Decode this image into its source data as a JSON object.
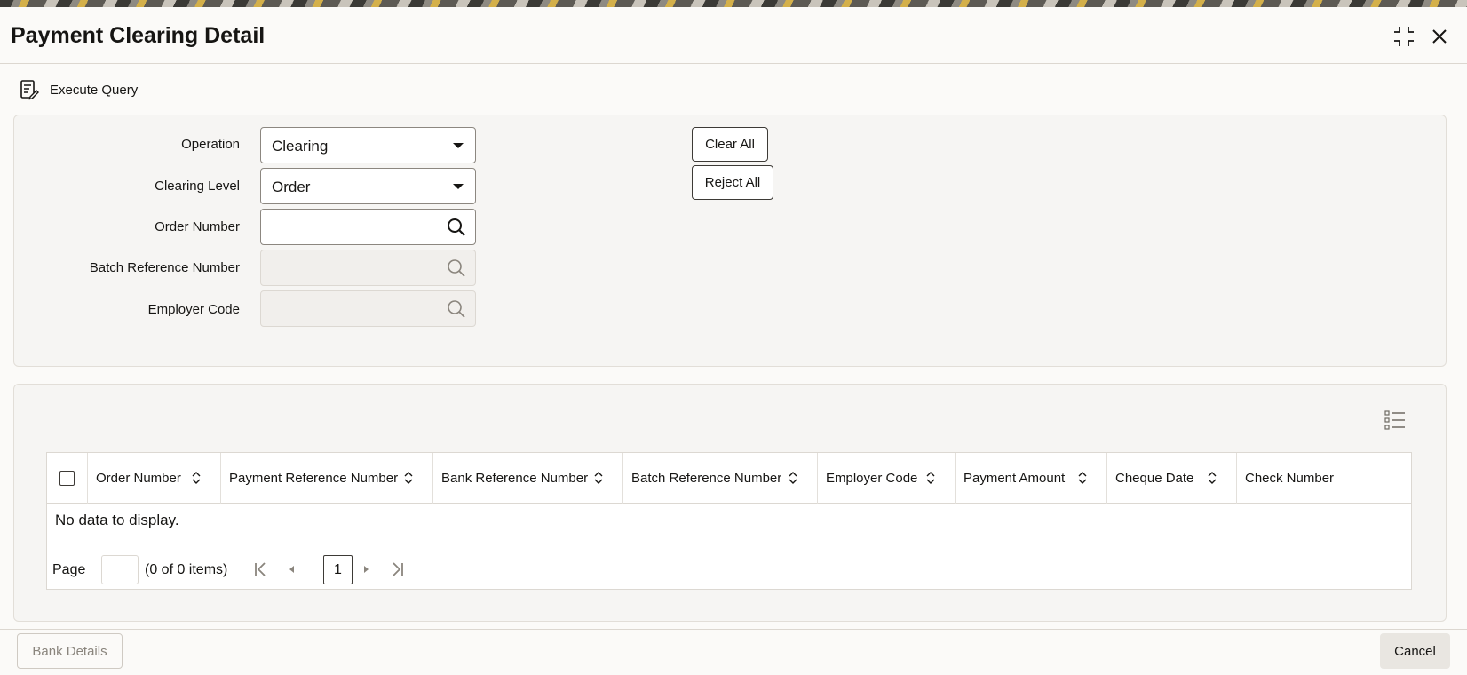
{
  "window": {
    "title": "Payment Clearing Detail"
  },
  "toolbar": {
    "execute_query_label": "Execute Query"
  },
  "form": {
    "operation": {
      "label": "Operation",
      "value": "Clearing"
    },
    "clearing_level": {
      "label": "Clearing Level",
      "value": "Order"
    },
    "order_number": {
      "label": "Order Number",
      "value": ""
    },
    "batch_reference_number": {
      "label": "Batch Reference Number",
      "value": ""
    },
    "employer_code": {
      "label": "Employer Code",
      "value": ""
    },
    "clear_all_label": "Clear All",
    "reject_all_label": "Reject All"
  },
  "table": {
    "columns": [
      "Order Number",
      "Payment Reference Number",
      "Bank Reference Number",
      "Batch Reference Number",
      "Employer Code",
      "Payment Amount",
      "Cheque Date",
      "Check Number"
    ],
    "empty_message": "No data to display.",
    "pagination": {
      "page_label": "Page",
      "page_input": "",
      "items_summary": "(0 of 0 items)",
      "current_page": "1"
    }
  },
  "footer": {
    "bank_details_label": "Bank Details",
    "cancel_label": "Cancel"
  },
  "icons": {
    "restore": "restore-icon",
    "close": "close-icon",
    "execute_query": "execute-query-icon",
    "dropdown": "chevron-down-icon",
    "search": "search-icon",
    "sort": "sort-icon",
    "grid_settings": "column-settings-icon",
    "first_page": "first-page-icon",
    "prev_page": "previous-page-icon",
    "next_page": "next-page-icon",
    "last_page": "last-page-icon"
  },
  "colors": {
    "text": "#161513",
    "panel_background": "#f6f5f3",
    "border": "#dcd8d2",
    "disabled_text": "#8a857d"
  }
}
